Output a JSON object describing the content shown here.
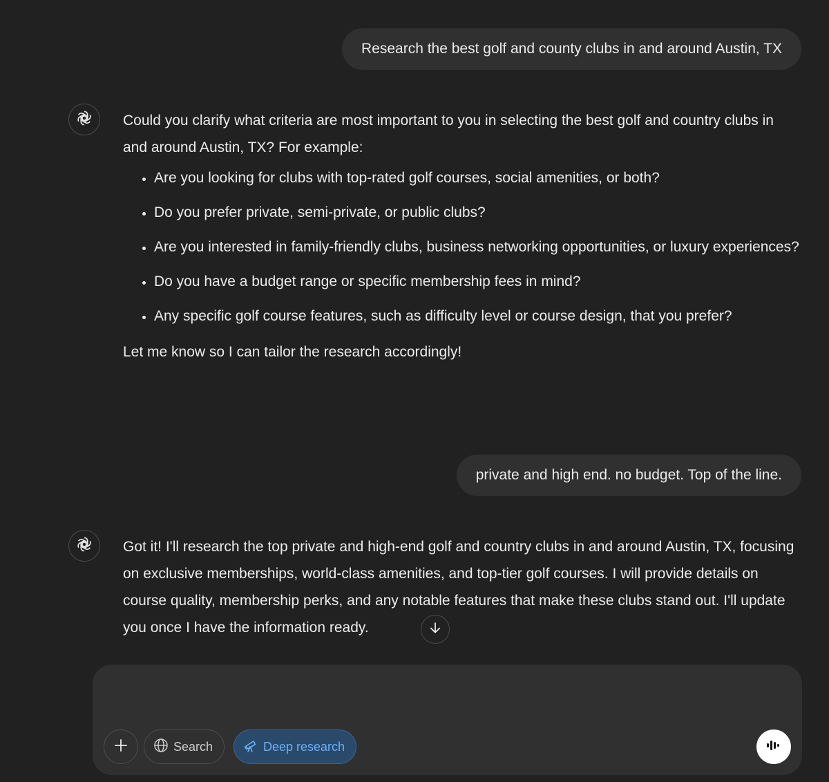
{
  "conversation": {
    "user_message_1": "Research the best golf and county clubs in and around Austin, TX",
    "assistant_message_1": {
      "intro": "Could you clarify what criteria are most important to you in selecting the best golf and country clubs in and around Austin, TX? For example:",
      "bullets": [
        "Are you looking for clubs with top-rated golf courses, social amenities, or both?",
        "Do you prefer private, semi-private, or public clubs?",
        "Are you interested in family-friendly clubs, business networking opportunities, or luxury experiences?",
        "Do you have a budget range or specific membership fees in mind?",
        "Any specific golf course features, such as difficulty level or course design, that you prefer?"
      ],
      "outro": "Let me know so I can tailor the research accordingly!"
    },
    "user_message_2": "private and high end. no budget. Top of the line.",
    "assistant_message_2": "Got it! I'll research the top private and high-end golf and country clubs in and around Austin, TX, focusing on exclusive memberships, world-class amenities, and top-tier golf courses. I will provide details on course quality, membership perks, and any notable features that make these clubs stand out. I'll update you once I have the information ready."
  },
  "composer": {
    "value": "",
    "search_label": "Search",
    "deep_research_label": "Deep research"
  },
  "icons": {
    "assistant_avatar": "openai-logo-icon",
    "scroll_down": "arrow-down-icon",
    "add": "plus-icon",
    "search": "globe-icon",
    "deep_research": "telescope-icon",
    "voice": "voice-waveform-icon"
  },
  "colors": {
    "background": "#212121",
    "bubble": "#303030",
    "text": "#ececec",
    "deep_research_bg": "#2a4a6b",
    "deep_research_text": "#6ab0f7"
  }
}
